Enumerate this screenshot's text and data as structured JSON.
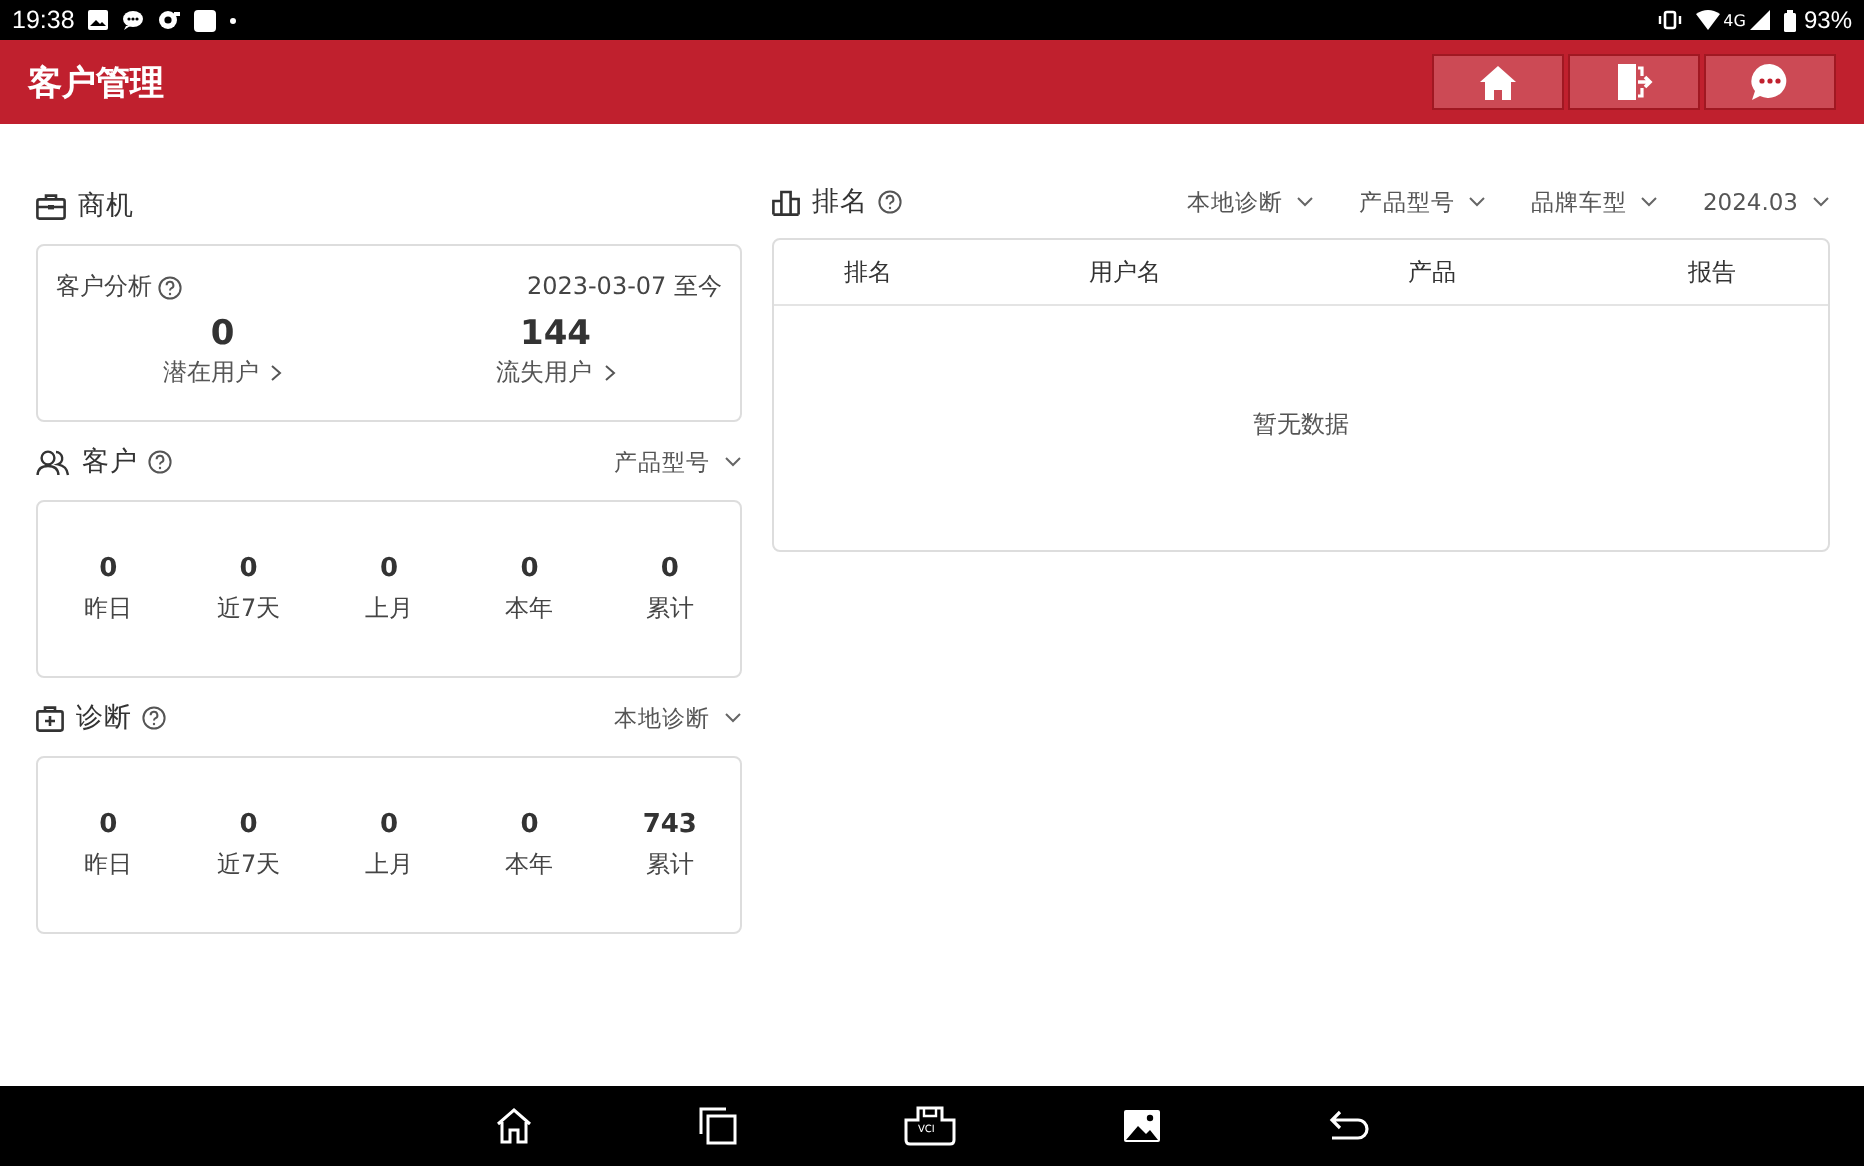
{
  "status_bar": {
    "time": "19:38",
    "network": "4G",
    "battery": "93%"
  },
  "header": {
    "title": "客户管理"
  },
  "opportunity": {
    "title": "商机",
    "card_title": "客户分析",
    "date_range": "2023-03-07 至今",
    "stats": [
      {
        "value": "0",
        "label": "潜在用户"
      },
      {
        "value": "144",
        "label": "流失用户"
      }
    ]
  },
  "customers": {
    "title": "客户",
    "filter": "产品型号",
    "stats": [
      {
        "value": "0",
        "label": "昨日"
      },
      {
        "value": "0",
        "label": "近7天"
      },
      {
        "value": "0",
        "label": "上月"
      },
      {
        "value": "0",
        "label": "本年"
      },
      {
        "value": "0",
        "label": "累计"
      }
    ]
  },
  "diagnosis": {
    "title": "诊断",
    "filter": "本地诊断",
    "stats": [
      {
        "value": "0",
        "label": "昨日"
      },
      {
        "value": "0",
        "label": "近7天"
      },
      {
        "value": "0",
        "label": "上月"
      },
      {
        "value": "0",
        "label": "本年"
      },
      {
        "value": "743",
        "label": "累计"
      }
    ]
  },
  "ranking": {
    "title": "排名",
    "filters": [
      "本地诊断",
      "产品型号",
      "品牌车型",
      "2024.03"
    ],
    "columns": [
      "排名",
      "用户名",
      "产品",
      "报告"
    ],
    "empty_text": "暂无数据"
  },
  "nav_bar": {
    "vci_label": "VCI"
  }
}
